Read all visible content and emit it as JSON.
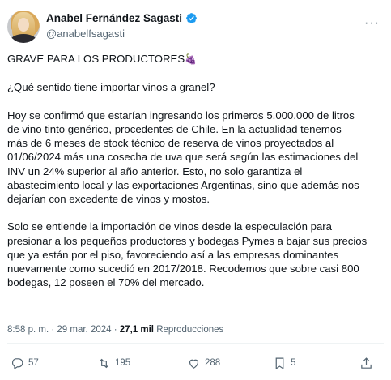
{
  "author": {
    "name": "Anabel Fernández Sagasti",
    "handle": "@anabelfsagasti"
  },
  "post": {
    "line1": "GRAVE PARA LOS PRODUCTORES",
    "line1_emoji": "🍇",
    "line2": "¿Qué sentido tiene importar vinos a granel?",
    "para1": [
      "Hoy se confirmó que estarían ingresando los primeros 5.000.000 de litros",
      "de vino tinto genérico, procedentes de Chile. En la actualidad  tenemos",
      "más de 6 meses de stock técnico de reserva de vinos proyectados al",
      "01/06/2024 más una cosecha de uva que será según las estimaciones del",
      "INV un 24% superior al año anterior. Esto, no solo garantiza el",
      "abastecimiento local y las exportaciones Argentinas, sino que además nos",
      "dejarían con excedente de vinos y mostos."
    ],
    "para2": [
      "Solo se entiende la importación de vinos desde la especulación para",
      "presionar a los pequeños productores y bodegas Pymes a bajar sus precios",
      "que ya están por el piso, favoreciendo así a las empresas dominantes",
      "nuevamente como sucedió en 2017/2018. Recodemos que sobre casi 800",
      "bodegas, 12 poseen el 70% del mercado."
    ]
  },
  "meta": {
    "time": "8:58 p. m.",
    "separator": "·",
    "date": "29 mar. 2024",
    "views_count": "27,1 mil",
    "views_label": "Reproducciones"
  },
  "actions": {
    "replies": "57",
    "reposts": "195",
    "likes": "288",
    "bookmarks": "5"
  },
  "icons": [
    "verified-badge-icon",
    "more-icon",
    "reply-icon",
    "repost-icon",
    "like-icon",
    "bookmark-icon",
    "share-icon"
  ],
  "colors": {
    "text": "#0f1419",
    "secondary": "#536471",
    "verified": "#1d9bf0",
    "divider": "#eff3f4"
  }
}
